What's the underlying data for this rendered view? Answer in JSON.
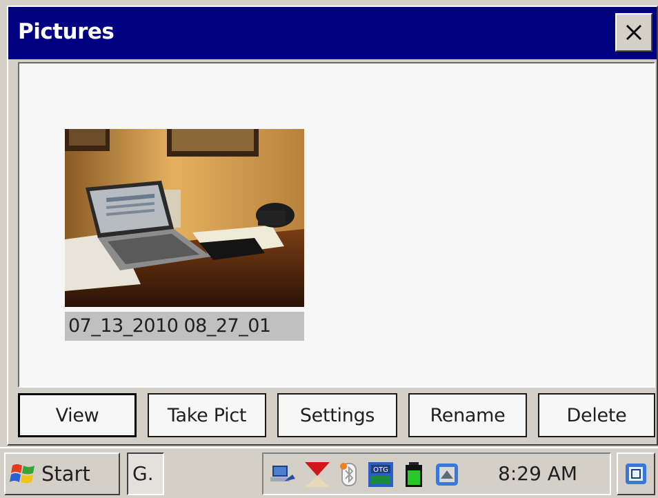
{
  "window": {
    "title": "Pictures",
    "close_icon": "close-icon"
  },
  "pictures": [
    {
      "caption": "07_13_2010 08_27_01",
      "thumbnail": "laptop-on-desk-photo",
      "selected": true
    }
  ],
  "buttons": {
    "view": "View",
    "take_pict": "Take Pict",
    "settings": "Settings",
    "rename": "Rename",
    "delete": "Delete"
  },
  "taskbar": {
    "start_label": "Start",
    "task_item": "G.",
    "clock": "8:29 AM",
    "tray_icons": [
      "network-icon",
      "signal-icon",
      "bluetooth-icon",
      "otg-client-icon",
      "battery-icon",
      "device-icon"
    ],
    "desktop_icon": "desktop-icon"
  },
  "colors": {
    "title_bar": "#000080",
    "chrome": "#d4d0c8",
    "caption_highlight": "#c0c0c0"
  }
}
